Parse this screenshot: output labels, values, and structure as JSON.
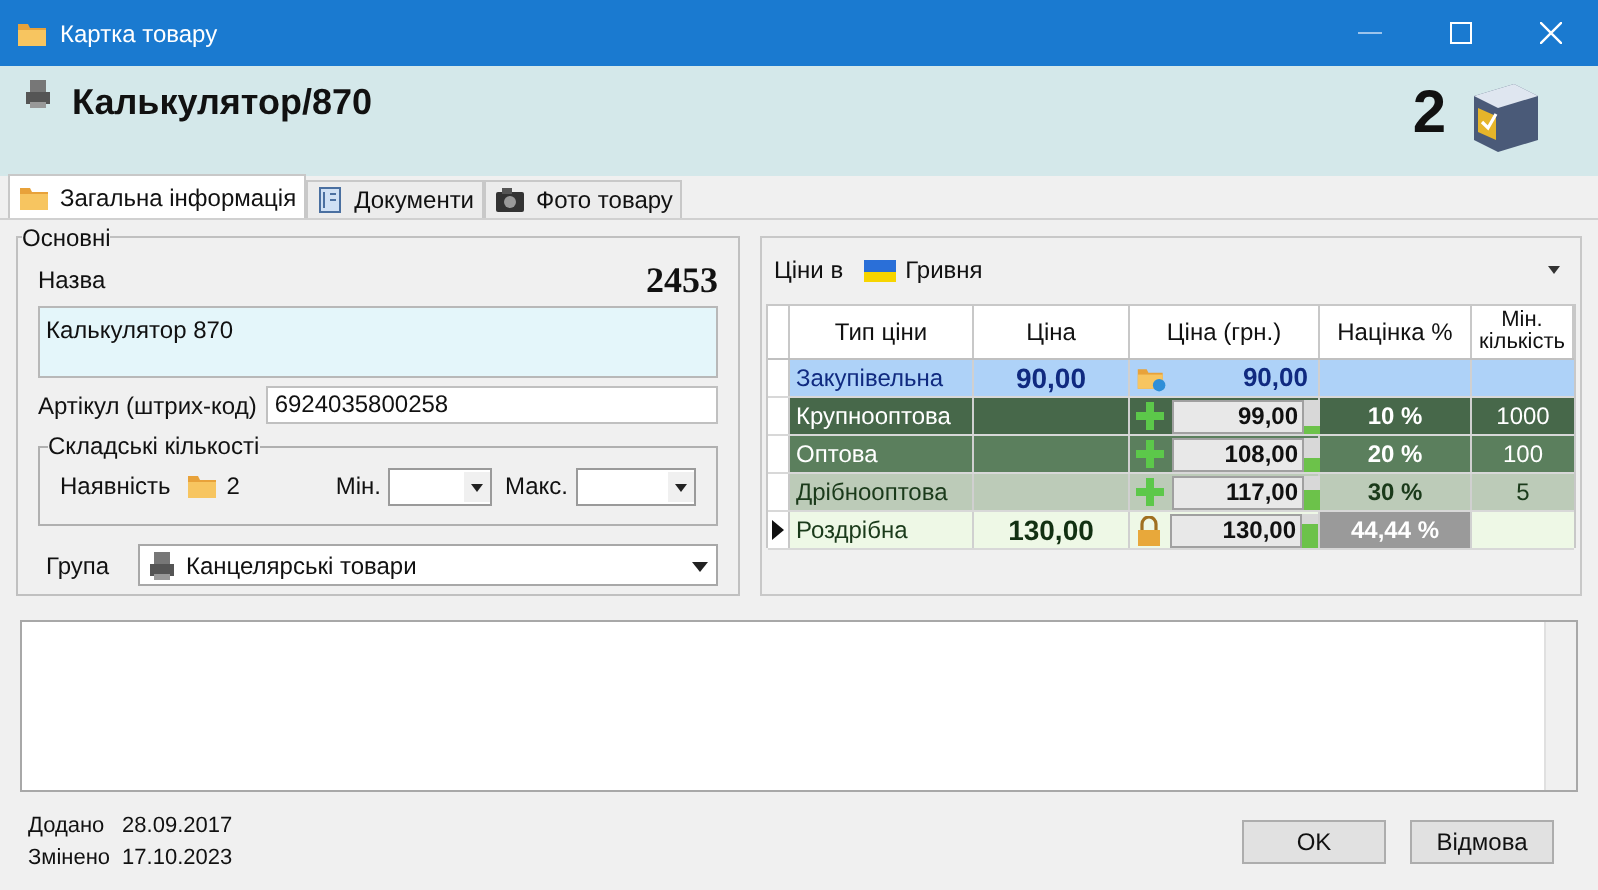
{
  "window": {
    "title": "Картка товару"
  },
  "header": {
    "title": "Калькулятор/870",
    "count": "2"
  },
  "tabs": [
    {
      "label": "Загальна інформація",
      "kind": "folder",
      "selected": true
    },
    {
      "label": "Документи",
      "kind": "notebook",
      "selected": false
    },
    {
      "label": "Фото товару",
      "kind": "camera",
      "selected": false
    }
  ],
  "basics": {
    "legend": "Основні",
    "id": "2453",
    "name_label": "Назва",
    "name_value": "Калькулятор 870",
    "sku_label": "Артікул (штрих-код)",
    "sku_value": "6924035800258",
    "stock": {
      "legend": "Складські кількості",
      "availability_label": "Наявність",
      "availability_value": "2",
      "min_label": "Мін.",
      "max_label": "Макс."
    },
    "group_label": "Група",
    "group_value": "Канцелярські товари"
  },
  "prices": {
    "label": "Ціни в",
    "currency": "Гривня",
    "columns": [
      "Тип ціни",
      "Ціна",
      "Ціна (грн.)",
      "Націнка %",
      "Мін. кількість"
    ],
    "rows": [
      {
        "type": "Закупівельна",
        "price": "90,00",
        "kind": "folder",
        "price_uah": "90,00",
        "markup": "",
        "min_qty": "",
        "color": "#aed2f8",
        "selected": false
      },
      {
        "type": "Крупнооптова",
        "price": "",
        "kind": "plus",
        "price_uah": "99,00",
        "level": 0.2,
        "markup": "10 %",
        "min_qty": "1000",
        "color": "#47684a",
        "selected": false
      },
      {
        "type": "Оптова",
        "price": "",
        "kind": "plus",
        "price_uah": "108,00",
        "level": 0.4,
        "markup": "20 %",
        "min_qty": "100",
        "color": "#5b7f5d",
        "selected": false
      },
      {
        "type": "Дрібнооптова",
        "price": "",
        "kind": "plus",
        "price_uah": "117,00",
        "level": 0.55,
        "markup": "30 %",
        "min_qty": "5",
        "color": "#bccbb8",
        "selected": false
      },
      {
        "type": "Роздрібна",
        "price": "130,00",
        "kind": "lock",
        "price_uah": "130,00",
        "level": 0.7,
        "markup": "44,44 %",
        "min_qty": "",
        "color": "#eef8e6",
        "selected": true
      }
    ]
  },
  "footer": {
    "added_label": "Додано",
    "added_value": "28.09.2017",
    "changed_label": "Змінено",
    "changed_value": "17.10.2023"
  },
  "buttons": [
    "OK",
    "Відмова"
  ]
}
